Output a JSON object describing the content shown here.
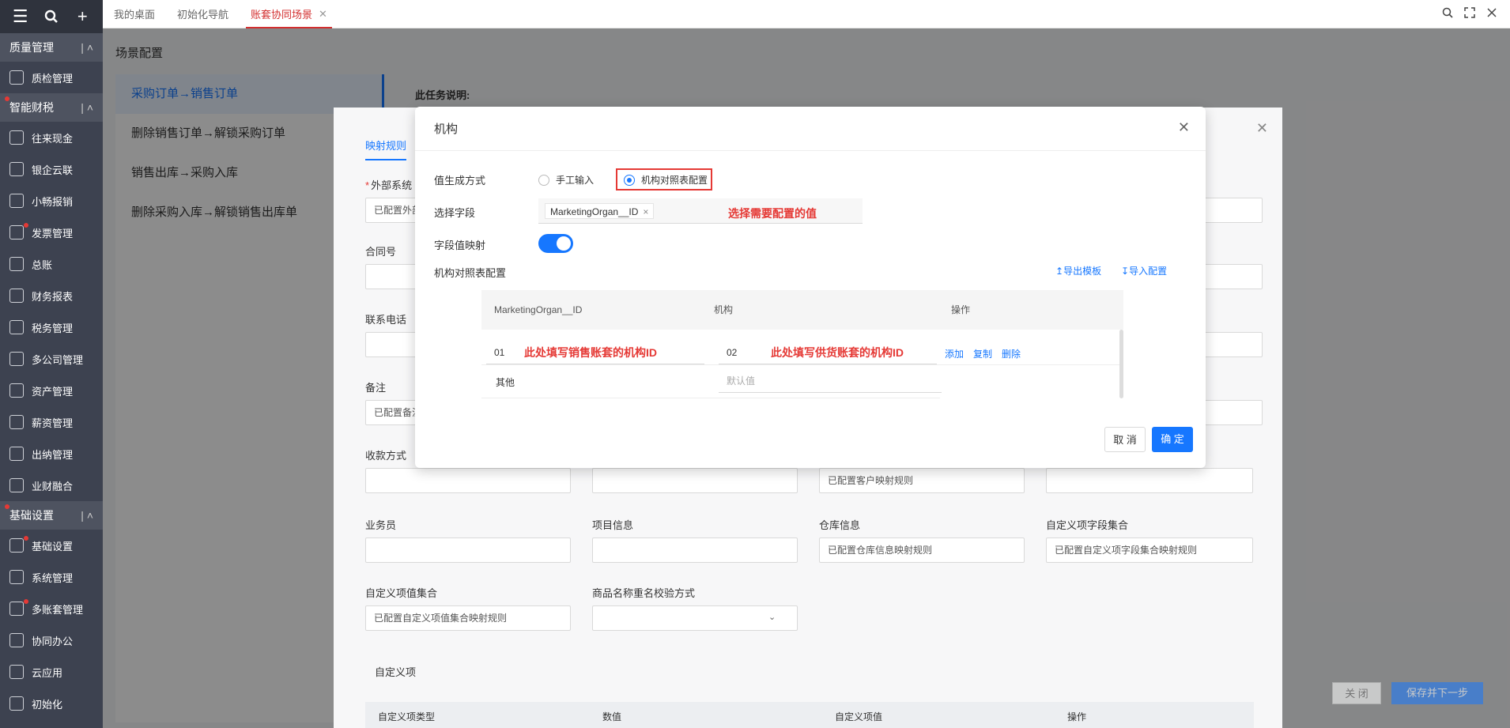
{
  "topbar": {
    "tabs": [
      "我的桌面",
      "初始化导航",
      "账套协同场景"
    ],
    "active_tab_close": "✕"
  },
  "sidebar": {
    "sections": [
      {
        "label": "质量管理",
        "items": [
          {
            "label": "质检管理",
            "dot": false
          }
        ]
      },
      {
        "label": "智能财税",
        "dot": true,
        "items": [
          {
            "label": "往来现金",
            "dot": false
          },
          {
            "label": "银企云联",
            "dot": false
          },
          {
            "label": "小畅报销",
            "dot": false
          },
          {
            "label": "发票管理",
            "dot": true
          },
          {
            "label": "总账",
            "dot": false
          },
          {
            "label": "财务报表",
            "dot": false
          },
          {
            "label": "税务管理",
            "dot": false
          },
          {
            "label": "多公司管理",
            "dot": false
          },
          {
            "label": "资产管理",
            "dot": false
          },
          {
            "label": "薪资管理",
            "dot": false
          },
          {
            "label": "出纳管理",
            "dot": false
          },
          {
            "label": "业财融合",
            "dot": false
          }
        ]
      },
      {
        "label": "基础设置",
        "dot": true,
        "items": [
          {
            "label": "基础设置",
            "dot": true
          },
          {
            "label": "系统管理",
            "dot": false
          },
          {
            "label": "多账套管理",
            "dot": true
          },
          {
            "label": "协同办公",
            "dot": false
          },
          {
            "label": "云应用",
            "dot": false
          },
          {
            "label": "初始化",
            "dot": false
          }
        ]
      }
    ]
  },
  "page": {
    "title": "场景配置",
    "scenes": [
      "采购订单→销售订单",
      "删除销售订单→解锁采购订单",
      "销售出库→采购入库",
      "删除采购入库→解锁销售出库单"
    ],
    "task_desc_label": "此任务说明:"
  },
  "mapping_dialog": {
    "tab": "映射规则",
    "fields": {
      "external_system": {
        "label": "外部系统",
        "value": "已配置外部"
      },
      "contract_no": {
        "label": "合同号"
      },
      "phone": {
        "label": "联系电话"
      },
      "remark": {
        "label": "备注",
        "value": "已配置备注"
      },
      "payment": {
        "label": "收款方式"
      },
      "customer": {
        "value": "已配置客户映射规则"
      },
      "salesman": {
        "label": "业务员"
      },
      "project": {
        "label": "项目信息"
      },
      "warehouse": {
        "label": "仓库信息",
        "value": "已配置仓库信息映射规则"
      },
      "custom_fieldset": {
        "label": "自定义项字段集合",
        "value": "已配置自定义项字段集合映射规则"
      },
      "custom_values": {
        "label": "自定义项值集合",
        "value": "已配置自定义项值集合映射规则"
      },
      "dup_check": {
        "label": "商品名称重名校验方式"
      }
    },
    "custom_section": "自定义项",
    "custom_cols": [
      "自定义项类型",
      "数值",
      "自定义项值",
      "操作"
    ],
    "close_btn": "关 闭",
    "save_next_btn": "保存并下一步"
  },
  "org_dialog": {
    "title": "机构",
    "value_gen_label": "值生成方式",
    "radio_manual": "手工输入",
    "radio_table": "机构对照表配置",
    "select_field_label": "选择字段",
    "selected_tag": "MarketingOrgan__ID",
    "annot_select": "选择需要配置的值",
    "field_map_label": "字段值映射",
    "org_table_label": "机构对照表配置",
    "export_tpl": "导出模板",
    "import_cfg": "导入配置",
    "columns": [
      "MarketingOrgan__ID",
      "机构",
      "操作"
    ],
    "row1": {
      "id": "01",
      "org": "02",
      "annot_id": "此处填写销售账套的机构ID",
      "annot_org": "此处填写供货账套的机构ID"
    },
    "ops": [
      "添加",
      "复制",
      "删除"
    ],
    "row2": {
      "label": "其他",
      "placeholder": "默认值"
    },
    "cancel": "取 消",
    "confirm": "确 定"
  }
}
